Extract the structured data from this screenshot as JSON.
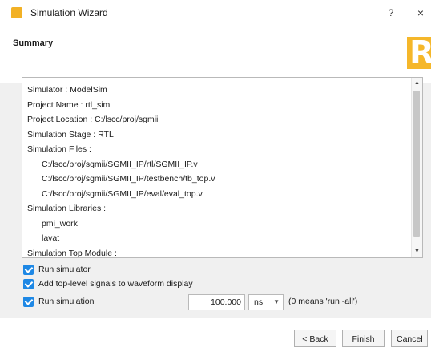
{
  "window": {
    "title": "Simulation Wizard",
    "help_glyph": "?",
    "close_glyph": "×"
  },
  "header": {
    "title": "Summary",
    "logo_letter": "R"
  },
  "summary": {
    "lines": [
      {
        "text": "Simulator : ModelSim",
        "indent": false
      },
      {
        "text": "Project Name : rtl_sim",
        "indent": false
      },
      {
        "text": "Project Location : C:/lscc/proj/sgmii",
        "indent": false
      },
      {
        "text": "Simulation Stage : RTL",
        "indent": false
      },
      {
        "text": "Simulation Files :",
        "indent": false
      },
      {
        "text": "C:/lscc/proj/sgmii/SGMII_IP/rtl/SGMII_IP.v",
        "indent": true
      },
      {
        "text": "C:/lscc/proj/sgmii/SGMII_IP/testbench/tb_top.v",
        "indent": true
      },
      {
        "text": "C:/lscc/proj/sgmii/SGMII_IP/eval/eval_top.v",
        "indent": true
      },
      {
        "text": "Simulation Libraries :",
        "indent": false
      },
      {
        "text": "pmi_work",
        "indent": true
      },
      {
        "text": "lavat",
        "indent": true
      },
      {
        "text": "Simulation Top Module :",
        "indent": false
      }
    ]
  },
  "options": {
    "run_simulator": {
      "label": "Run simulator",
      "checked": true
    },
    "add_signals": {
      "label": "Add top-level signals to waveform display",
      "checked": true
    },
    "run_simulation": {
      "label": "Run simulation",
      "checked": true,
      "value": "100.000",
      "unit": "ns",
      "hint": "(0 means 'run -all')"
    }
  },
  "footer": {
    "back_label": "< Back",
    "finish_label": "Finish",
    "cancel_label": "Cancel"
  },
  "colors": {
    "checkbox": "#1e88e5",
    "logo": "#f5b72a",
    "dialog_bg": "#f0f0f0"
  }
}
